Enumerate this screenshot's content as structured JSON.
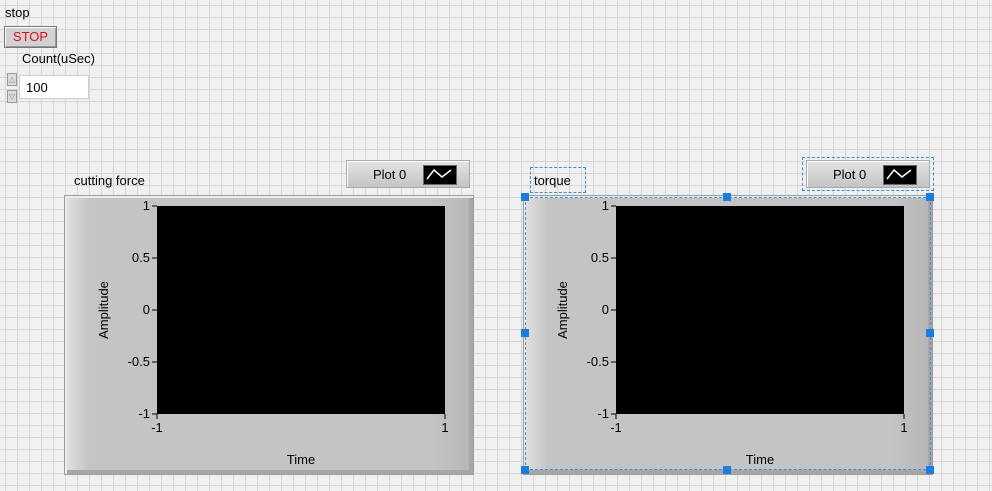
{
  "stop_control": {
    "label": "stop",
    "button_text": "STOP"
  },
  "count_control": {
    "label": "Count(uSec)",
    "value": "100"
  },
  "charts": [
    {
      "label": "cutting force",
      "legend": {
        "plot_name": "Plot 0"
      },
      "x_label": "Time",
      "y_label": "Amplitude",
      "x_ticks": [
        "-1",
        "1"
      ],
      "y_ticks": [
        "1",
        "0.5",
        "0",
        "-0.5",
        "-1"
      ],
      "selected": false
    },
    {
      "label": "torque",
      "legend": {
        "plot_name": "Plot 0"
      },
      "x_label": "Time",
      "y_label": "Amplitude",
      "x_ticks": [
        "-1",
        "1"
      ],
      "y_ticks": [
        "1",
        "0.5",
        "0",
        "-0.5",
        "-1"
      ],
      "selected": true
    }
  ],
  "chart_data": [
    {
      "type": "line",
      "title": "cutting force",
      "xlabel": "Time",
      "ylabel": "Amplitude",
      "xlim": [
        -1,
        1
      ],
      "ylim": [
        -1,
        1
      ],
      "series": [
        {
          "name": "Plot 0",
          "x": [],
          "y": []
        }
      ],
      "background": "#000000"
    },
    {
      "type": "line",
      "title": "torque",
      "xlabel": "Time",
      "ylabel": "Amplitude",
      "xlim": [
        -1,
        1
      ],
      "ylim": [
        -1,
        1
      ],
      "series": [
        {
          "name": "Plot 0",
          "x": [],
          "y": []
        }
      ],
      "background": "#000000"
    }
  ],
  "colors": {
    "panel_bg": "#f0f0f0",
    "grid": "#d6d6d6",
    "stop_text": "#e0101a",
    "plot_bg": "#000000",
    "selection": "#1a7de0"
  }
}
